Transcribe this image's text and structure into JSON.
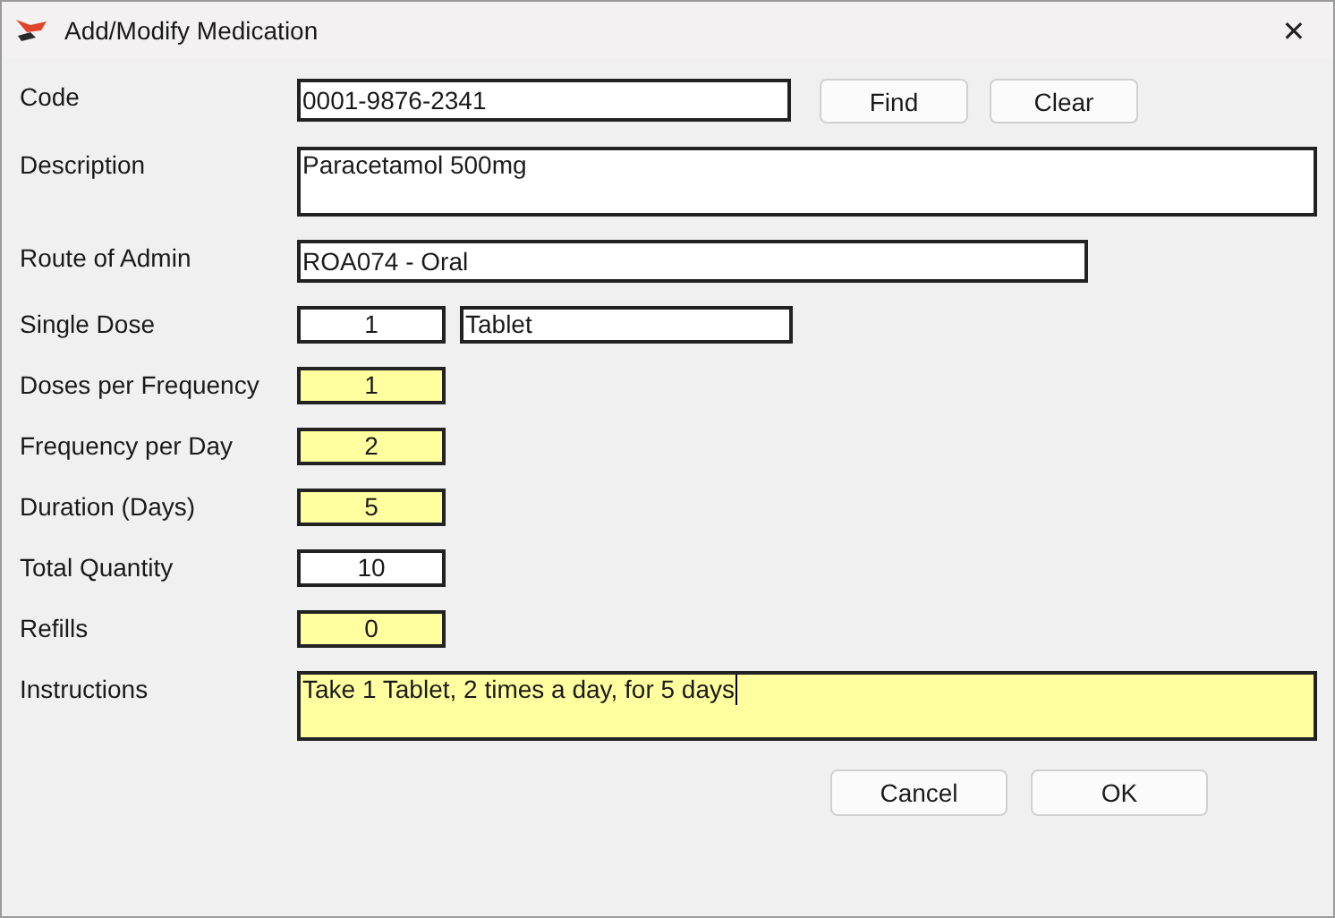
{
  "window": {
    "title": "Add/Modify Medication",
    "close": "✕"
  },
  "rows": [
    {
      "label": "Code",
      "fields": [
        {
          "kind": "code",
          "value": "0001-9876-2341",
          "required": false,
          "focused": false
        }
      ],
      "buttons": [
        "Find",
        "Clear"
      ]
    },
    {
      "label": "Description",
      "fields": [
        {
          "kind": "memo",
          "value": "Paracetamol 500mg",
          "required": false,
          "focused": false
        }
      ]
    },
    {
      "label": "Route of Admin",
      "fields": [
        {
          "kind": "lookup",
          "value": "ROA074 - Oral",
          "required": false,
          "focused": false
        }
      ]
    },
    {
      "label": "Single Dose",
      "fields": [
        {
          "kind": "number",
          "value": "1",
          "required": false,
          "focused": false
        },
        {
          "kind": "unit",
          "value": "Tablet",
          "required": false,
          "focused": false
        }
      ]
    },
    {
      "label": "Doses per Frequency",
      "fields": [
        {
          "kind": "number",
          "value": "1",
          "required": true,
          "focused": false
        }
      ]
    },
    {
      "label": "Frequency per Day",
      "fields": [
        {
          "kind": "number",
          "value": "2",
          "required": true,
          "focused": false
        }
      ]
    },
    {
      "label": "Duration (Days)",
      "fields": [
        {
          "kind": "number",
          "value": "5",
          "required": true,
          "focused": false
        }
      ]
    },
    {
      "label": "Total Quantity",
      "fields": [
        {
          "kind": "number",
          "value": "10",
          "required": false,
          "focused": false
        }
      ]
    },
    {
      "label": "Refills",
      "fields": [
        {
          "kind": "number",
          "value": "0",
          "required": true,
          "focused": false
        }
      ]
    },
    {
      "label": "Instructions",
      "fields": [
        {
          "kind": "memo",
          "value": "Take 1 Tablet, 2 times a day, for 5 days",
          "required": true,
          "focused": true
        }
      ]
    }
  ],
  "buttons": [
    "Cancel",
    "OK"
  ]
}
